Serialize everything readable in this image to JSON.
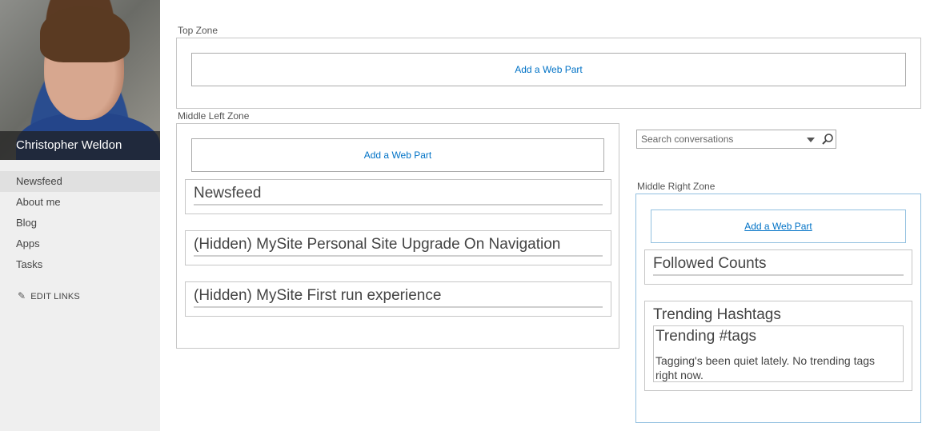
{
  "profile": {
    "name": "Christopher Weldon"
  },
  "nav": {
    "items": [
      {
        "label": "Newsfeed"
      },
      {
        "label": "About me"
      },
      {
        "label": "Blog"
      },
      {
        "label": "Apps"
      },
      {
        "label": "Tasks"
      }
    ],
    "edit_links": "EDIT LINKS"
  },
  "zones": {
    "top": {
      "label": "Top Zone",
      "add_webpart": "Add a Web Part"
    },
    "middle_left": {
      "label": "Middle Left Zone",
      "add_webpart": "Add a Web Part",
      "webparts": [
        {
          "title": "Newsfeed"
        },
        {
          "title": "(Hidden) MySite Personal Site Upgrade On Navigation"
        },
        {
          "title": "(Hidden) MySite First run experience"
        }
      ]
    },
    "middle_right": {
      "label": "Middle Right Zone",
      "add_webpart": "Add a Web Part",
      "followed_counts": {
        "title": "Followed Counts"
      },
      "trending": {
        "title": "Trending Hashtags",
        "inner_title": "Trending #tags",
        "message": "Tagging's been quiet lately. No trending tags right now."
      }
    }
  },
  "search": {
    "placeholder": "Search conversations"
  },
  "colors": {
    "link": "#0072c6",
    "nav_bg": "#efefef",
    "selected_bg": "#e0e0e0",
    "zone_border": "#c6c6c6",
    "active_border": "#92c0e0"
  }
}
